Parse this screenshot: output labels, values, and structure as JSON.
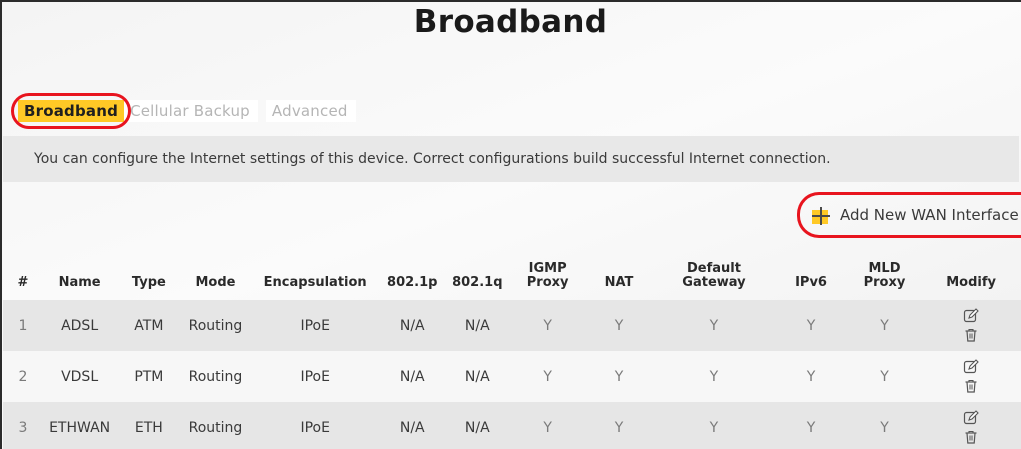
{
  "page": {
    "title": "Broadband"
  },
  "tabs": [
    {
      "label": "Broadband",
      "active": true
    },
    {
      "label": "Cellular Backup",
      "active": false
    },
    {
      "label": "Advanced",
      "active": false
    }
  ],
  "description": "You can configure the Internet settings of this device. Correct configurations build successful Internet connection.",
  "add_button": {
    "label": "Add New WAN Interface",
    "icon": "plus-icon"
  },
  "table": {
    "headers": [
      "#",
      "Name",
      "Type",
      "Mode",
      "Encapsulation",
      "802.1p",
      "802.1q",
      "IGMP\nProxy",
      "NAT",
      "Default\nGateway",
      "IPv6",
      "MLD\nProxy",
      "Modify"
    ],
    "rows": [
      [
        "1",
        "ADSL",
        "ATM",
        "Routing",
        "IPoE",
        "N/A",
        "N/A",
        "Y",
        "Y",
        "Y",
        "Y",
        "Y"
      ],
      [
        "2",
        "VDSL",
        "PTM",
        "Routing",
        "IPoE",
        "N/A",
        "N/A",
        "Y",
        "Y",
        "Y",
        "Y",
        "Y"
      ],
      [
        "3",
        "ETHWAN",
        "ETH",
        "Routing",
        "IPoE",
        "N/A",
        "N/A",
        "Y",
        "Y",
        "Y",
        "Y",
        "Y"
      ]
    ],
    "row_actions": [
      "edit-icon",
      "delete-icon"
    ]
  },
  "colors": {
    "accent": "#ffc926",
    "highlight": "#e8141e",
    "desc_bg": "#e8e8e8",
    "row_shade": "#e6e6e6"
  }
}
